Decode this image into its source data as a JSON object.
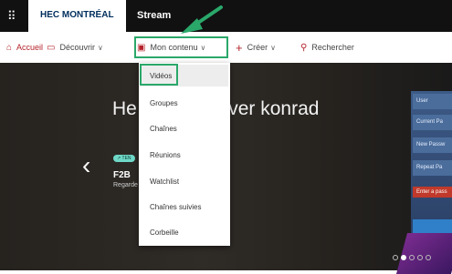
{
  "topbar": {
    "brand": "HEC MONTRÉAL",
    "app": "Stream"
  },
  "nav": {
    "accueil": "Accueil",
    "decouvrir": "Découvrir",
    "mon_contenu": "Mon contenu",
    "creer": "Créer",
    "rechercher": "Rechercher"
  },
  "hero": {
    "title": "He                ous retrouver konrad",
    "badge": "TEN",
    "card_title": "F2B",
    "card_sub": "Regarde"
  },
  "side_panel": {
    "fields": [
      "User",
      "Current Pa",
      "New Passw",
      "Repeat Pa",
      "Enter a pass"
    ]
  },
  "dropdown": {
    "items": [
      "Vidéos",
      "Groupes",
      "Chaînes",
      "Réunions",
      "Watchlist",
      "Chaînes suivies",
      "Corbeille"
    ]
  },
  "carousel": {
    "count": 5,
    "active_index": 1
  },
  "colors": {
    "accent": "#b4232b",
    "highlight_outline": "#2aa86a",
    "topbar": "#111111"
  }
}
